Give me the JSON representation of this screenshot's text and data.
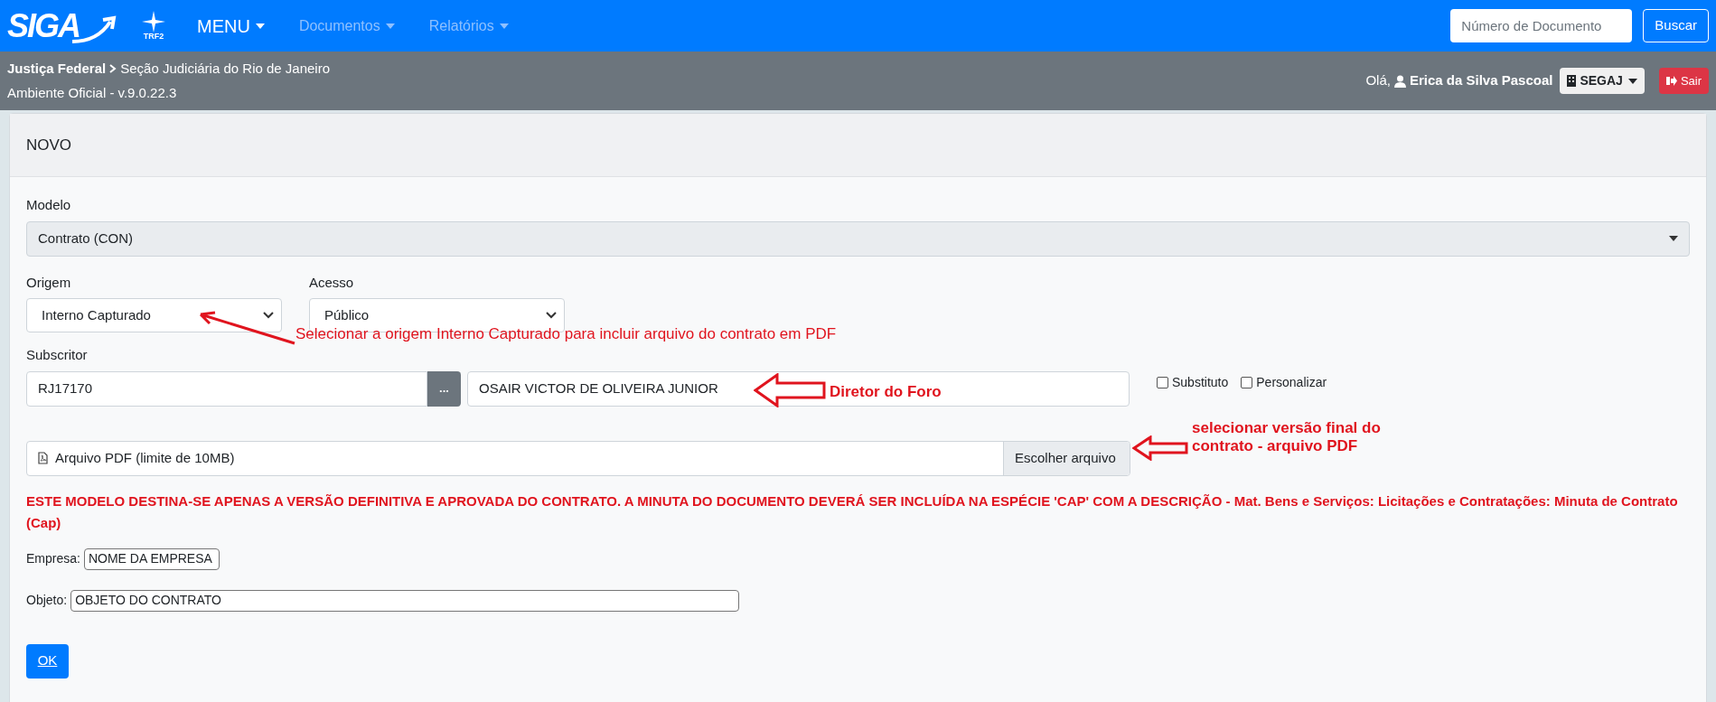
{
  "navbar": {
    "logo": "SIGA",
    "emblem_label": "TRF2",
    "menu": "MENU",
    "links": [
      {
        "label": "Documentos"
      },
      {
        "label": "Relatórios"
      }
    ],
    "search": {
      "placeholder": "Número de Documento"
    },
    "search_button": "Buscar"
  },
  "context_bar": {
    "breadcrumb": [
      "Justiça Federal",
      "Seção Judiciária do Rio de Janeiro"
    ],
    "environment": "Ambiente Oficial - v.9.0.22.3",
    "greeting": "Olá,",
    "user": "Erica da Silva Pascoal",
    "unit": "SEGAJ",
    "logout": "Sair"
  },
  "card": {
    "title": "NOVO"
  },
  "form": {
    "modelo": {
      "label": "Modelo",
      "value": "Contrato (CON)"
    },
    "origem": {
      "label": "Origem",
      "value": "Interno Capturado"
    },
    "acesso": {
      "label": "Acesso",
      "value": "Público"
    },
    "subscritor": {
      "label": "Subscritor",
      "code": "RJ17170",
      "lookup": "...",
      "name": "OSAIR VICTOR DE OLIVEIRA JUNIOR"
    },
    "checkboxes": [
      {
        "label": "Substituto",
        "checked": false
      },
      {
        "label": "Personalizar",
        "checked": false
      }
    ],
    "file": {
      "placeholder": "Arquivo PDF (limite de 10MB)",
      "button": "Escolher arquivo"
    },
    "notice": "ESTE MODELO DESTINA-SE APENAS A VERSÃO DEFINITIVA E APROVADA DO CONTRATO. A MINUTA DO DOCUMENTO DEVERÁ SER INCLUÍDA NA ESPÉCIE 'CAP' COM A DESCRIÇÃO - Mat. Bens e Serviços: Licitações e Contratações: Minuta de Contrato (Cap)",
    "empresa": {
      "label": "Empresa:",
      "value": "NOME DA EMPRESA"
    },
    "objeto": {
      "label": "Objeto:",
      "value": "OBJETO DO CONTRATO"
    },
    "submit": "OK"
  },
  "annotations": [
    {
      "text": "Selecionar a origem Interno Capturado para incluir arquivo do contrato em PDF"
    },
    {
      "text": "Diretor do Foro"
    },
    {
      "text": "selecionar versão final do contrato - arquivo PDF"
    }
  ]
}
